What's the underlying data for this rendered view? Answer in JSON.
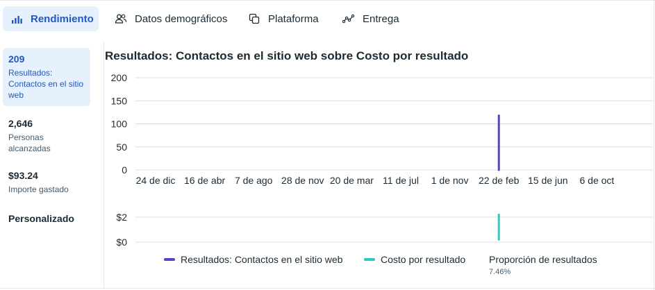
{
  "tabs": [
    {
      "label": "Rendimiento",
      "icon": "bar-chart-icon",
      "active": true
    },
    {
      "label": "Datos demográficos",
      "icon": "people-icon"
    },
    {
      "label": "Plataforma",
      "icon": "platform-icon"
    },
    {
      "label": "Entrega",
      "icon": "delivery-icon"
    }
  ],
  "sidebar": {
    "metrics": [
      {
        "value": "209",
        "label": "Resultados: Contactos en el sitio web",
        "active": true
      },
      {
        "value": "2,646",
        "label": "Personas alcanzadas"
      },
      {
        "value": "$93.24",
        "label": "Importe gastado"
      }
    ],
    "custom_label": "Personalizado"
  },
  "chart": {
    "title": "Resultados: Contactos en el sitio web sobre Costo por resultado"
  },
  "legend": {
    "results_label": "Resultados: Contactos en el sitio web",
    "cost_label": "Costo por resultado",
    "ratio_label": "Proporción de resultados",
    "ratio_value": "7.46%"
  },
  "colors": {
    "accent": "#1e5ac2",
    "active_bg": "#e7f0fd",
    "results_series": "#5b3fc4",
    "cost_series": "#2ccbc0"
  },
  "chart_data": [
    {
      "type": "line",
      "title": "Resultados: Contactos en el sitio web sobre Costo por resultado",
      "x": [
        "24 de dic",
        "16 de abr",
        "7 de ago",
        "28 de nov",
        "20 de mar",
        "11 de jul",
        "1 de nov",
        "22 de feb",
        "15 de jun",
        "6 de oct"
      ],
      "ylim": [
        0,
        200
      ],
      "yticks": [
        "200",
        "150",
        "100",
        "50",
        "0"
      ],
      "grid": true,
      "series": [
        {
          "name": "Resultados: Contactos en el sitio web",
          "color": "#5b3fc4",
          "points": [
            {
              "x": "22 de feb",
              "y": 0
            },
            {
              "x": "22 de feb",
              "y": 118
            }
          ]
        }
      ]
    },
    {
      "type": "line",
      "ylim": [
        0,
        2
      ],
      "yticks": [
        "$2",
        "$0"
      ],
      "grid": true,
      "series": [
        {
          "name": "Costo por resultado",
          "color": "#2ccbc0",
          "points": [
            {
              "x": "22 de feb",
              "y": 0.2
            },
            {
              "x": "22 de feb",
              "y": 2.2
            }
          ]
        }
      ]
    }
  ]
}
